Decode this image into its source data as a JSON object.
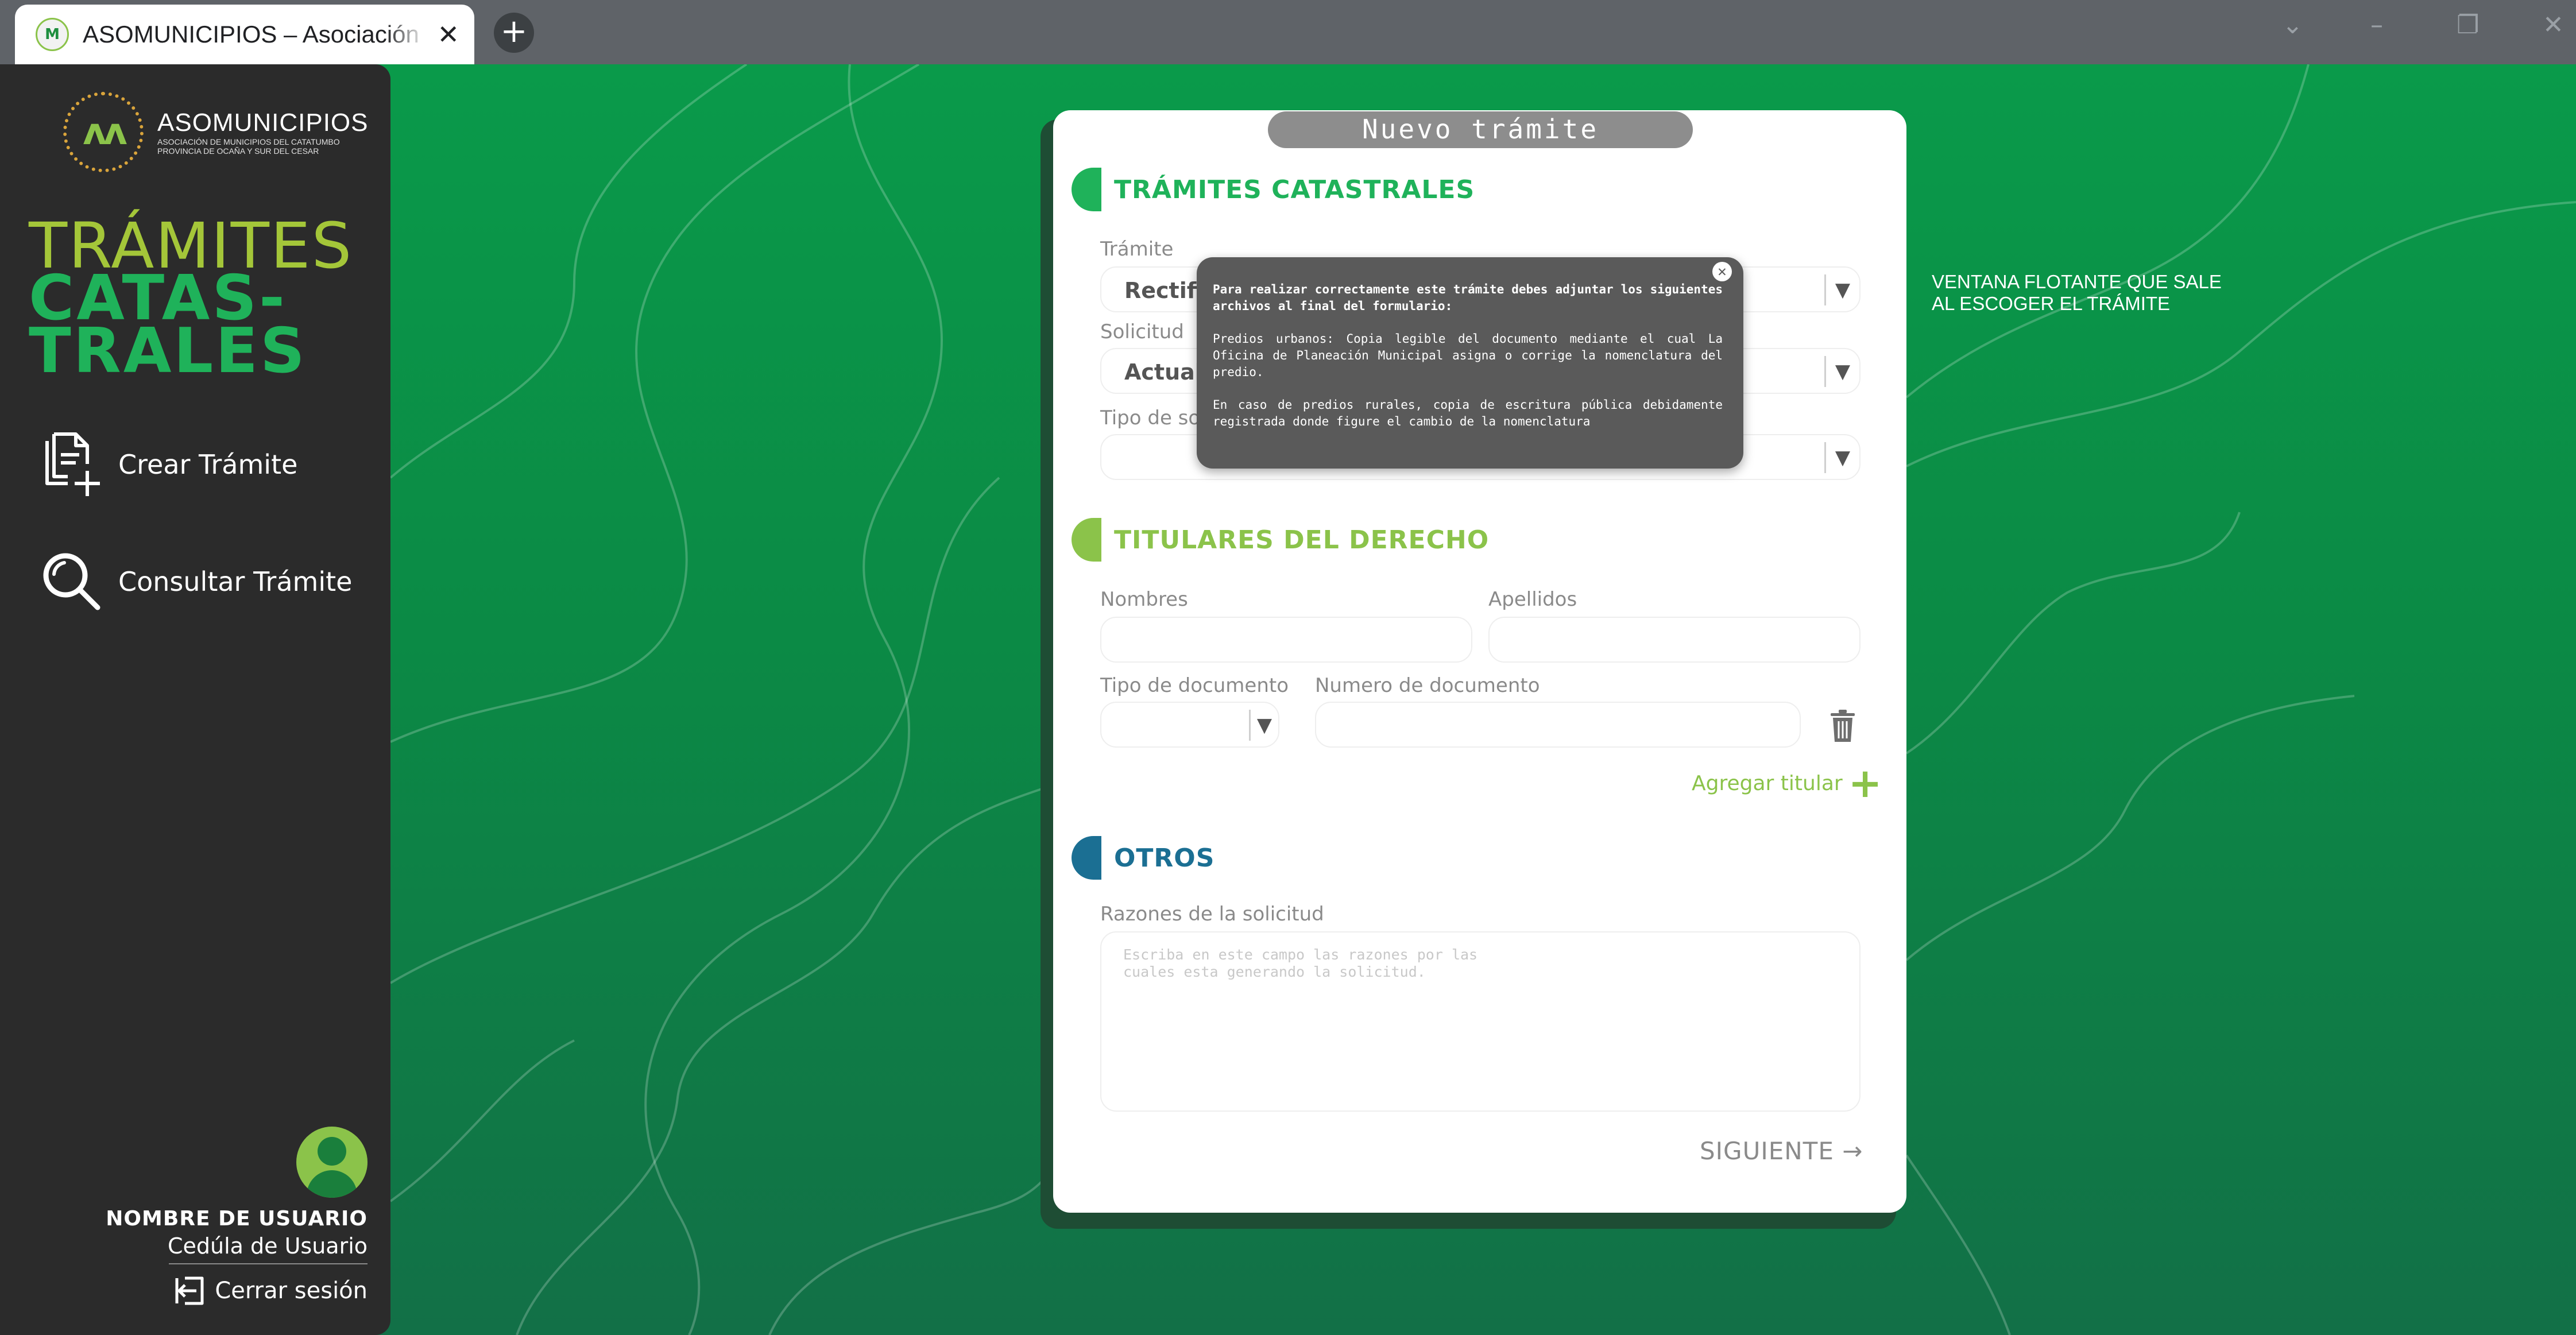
{
  "browser": {
    "tab_title": "ASOMUNICIPIOS – Asociación de Municipios",
    "tab_close_icon": "✕",
    "new_tab_icon": "+"
  },
  "sidebar": {
    "logo_title": "ASOMUNICIPIOS",
    "logo_sub1": "ASOCIACIÓN DE MUNICIPIOS DEL CATATUMBO",
    "logo_sub2": "PROVINCIA DE OCAÑA Y SUR DEL CESAR",
    "heading_line1": "TRÁMITES",
    "heading_line2": "CATAS-",
    "heading_line3": "TRALES",
    "nav": [
      {
        "label": "Crear Trámite",
        "icon": "document-add-icon"
      },
      {
        "label": "Consultar Trámite",
        "icon": "search-icon"
      }
    ],
    "user_name": "NOMBRE DE USUARIO",
    "user_id": "Cedúla de Usuario",
    "logout_label": "Cerrar sesión"
  },
  "form": {
    "title": "Nuevo trámite",
    "sections": {
      "catastrales": "TRÁMITES CATASTRALES",
      "titulares": "TITULARES DEL DERECHO",
      "otros": "OTROS"
    },
    "tramite_label": "Trámite",
    "tramite_value": "Rectifi",
    "solicitud_label": "Solicitud",
    "solicitud_value": "Actual",
    "tipo_label": "Tipo de so",
    "nombres_label": "Nombres",
    "apellidos_label": "Apellidos",
    "tipo_doc_label": "Tipo de documento",
    "num_doc_label": "Numero de documento",
    "agregar_label": "Agregar titular",
    "razones_label": "Razones de la solicitud",
    "razones_placeholder": "Escriba en este campo las razones por las cuales esta generando la solicitud.",
    "siguiente_label": "SIGUIENTE →",
    "caret": "▼"
  },
  "tooltip": {
    "intro": "Para realizar correctamente este trámite debes adjuntar los siguientes archivos al final del formulario:",
    "urbanos": "Predios urbanos: Copia legible del documento mediante el cual La Oficina de Planeación Municipal asigna o corrige la nomenclatura del predio.",
    "rurales": "En caso de predios rurales, copia de escritura pública debidamente registrada donde figure el cambio de la nomenclatura",
    "close": "✕"
  },
  "annotation": {
    "line1": "VENTANA FLOTANTE QUE SALE",
    "line2": "AL ESCOGER EL TRÁMITE"
  },
  "colors": {
    "catastrales": "#1fb25a",
    "titulares": "#8bc34a",
    "otros": "#1b6f93"
  }
}
